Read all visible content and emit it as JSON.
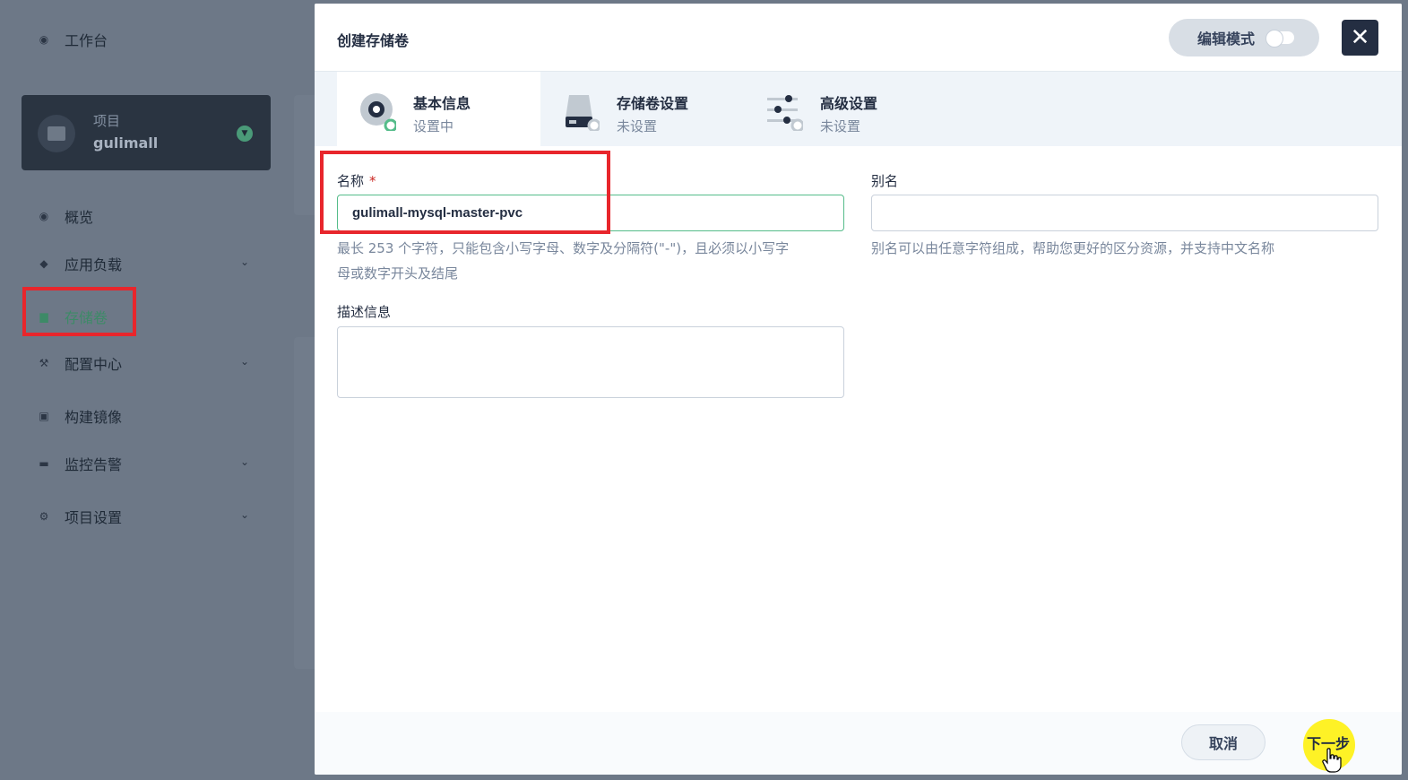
{
  "sidebar": {
    "workbench_label": "工作台",
    "project": {
      "label": "项目",
      "name": "gulimall"
    },
    "items": [
      {
        "label": "概览",
        "icon": "dashboard-icon",
        "has_submenu": false
      },
      {
        "label": "应用负载",
        "icon": "layers-icon",
        "has_submenu": true
      },
      {
        "label": "存储卷",
        "icon": "storage-icon",
        "has_submenu": false,
        "selected": true
      },
      {
        "label": "配置中心",
        "icon": "hammer-icon",
        "has_submenu": true
      },
      {
        "label": "构建镜像",
        "icon": "image-icon",
        "has_submenu": false
      },
      {
        "label": "监控告警",
        "icon": "monitor-icon",
        "has_submenu": true
      },
      {
        "label": "项目设置",
        "icon": "gear-icon",
        "has_submenu": true
      }
    ]
  },
  "modal": {
    "title": "创建存储卷",
    "edit_mode_label": "编辑模式",
    "steps": [
      {
        "title": "基本信息",
        "status": "设置中",
        "icon": "disc-icon"
      },
      {
        "title": "存储卷设置",
        "status": "未设置",
        "icon": "drive-icon"
      },
      {
        "title": "高级设置",
        "status": "未设置",
        "icon": "sliders-icon"
      }
    ],
    "form": {
      "name_label": "名称",
      "required_mark": "*",
      "name_value": "gulimall-mysql-master-pvc",
      "name_hint_line1": "最长 253 个字符，只能包含小写字母、数字及分隔符(\"-\")，且必须以小写字",
      "name_hint_line2": "母或数字开头及结尾",
      "alias_label": "别名",
      "alias_value": "",
      "alias_hint": "别名可以由任意字符组成，帮助您更好的区分资源，并支持中文名称",
      "description_label": "描述信息",
      "description_value": ""
    },
    "footer": {
      "cancel_label": "取消",
      "next_label": "下一步"
    }
  },
  "colors": {
    "accent": "#55bc8a",
    "dark": "#242e42",
    "highlight": "#e8262c",
    "cursor_glow": "#fff000"
  }
}
